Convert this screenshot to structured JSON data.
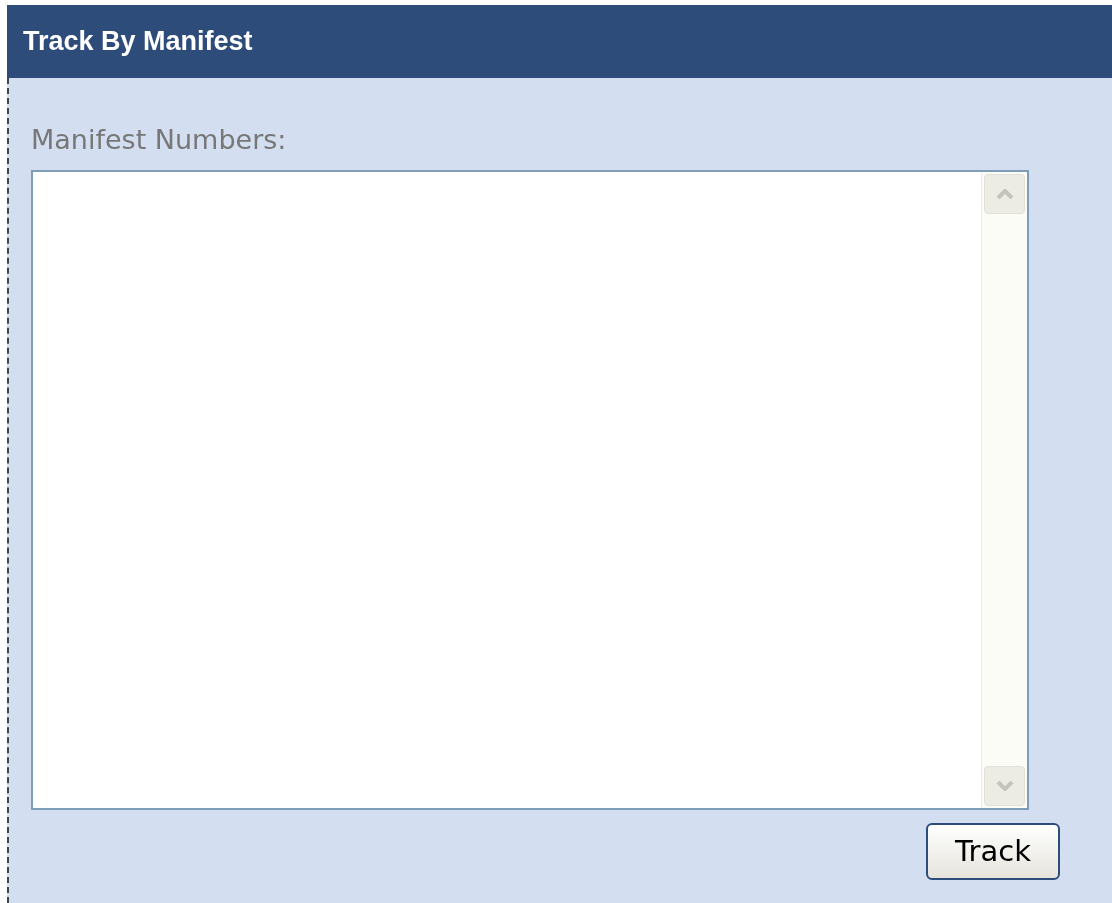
{
  "panel": {
    "title": "Track By Manifest"
  },
  "form": {
    "label": "Manifest Numbers:",
    "button": "Track"
  }
}
